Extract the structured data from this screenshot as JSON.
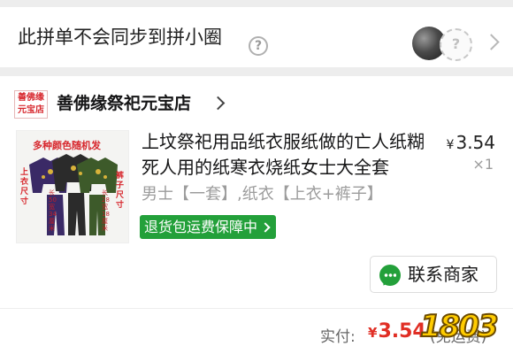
{
  "sync": {
    "text": "此拼单不会同步到拼小圈",
    "help_glyph": "?",
    "placeholder_avatar_glyph": "?"
  },
  "store": {
    "logo_text": "善佛缘\n元宝店",
    "name": "善佛缘祭祀元宝店"
  },
  "product": {
    "title": "上坟祭祀用品纸衣服纸做的亡人纸糊死人用的纸寒衣烧纸女士大全套",
    "price": "3.54",
    "currency": "¥",
    "quantity": "×1",
    "spec": "男士【一套】,纸衣【上衣+裤子】",
    "badge": "退货包运费保障中",
    "image_text": {
      "banner": "多种颜色随机发",
      "left_label": "上衣尺寸",
      "right_label": "裤子尺寸",
      "left_size": "长50宽34厘米",
      "right_size": "长28宽18厘米"
    }
  },
  "actions": {
    "contact_label": "联系商家"
  },
  "total": {
    "label": "实付:",
    "currency": "¥",
    "amount": "3.54",
    "note": "(免运费)"
  },
  "watermark": {
    "text": "1803"
  },
  "colors": {
    "accent_green": "#23a03a",
    "price_red": "#e02e24",
    "logo_red": "#d7262c"
  }
}
